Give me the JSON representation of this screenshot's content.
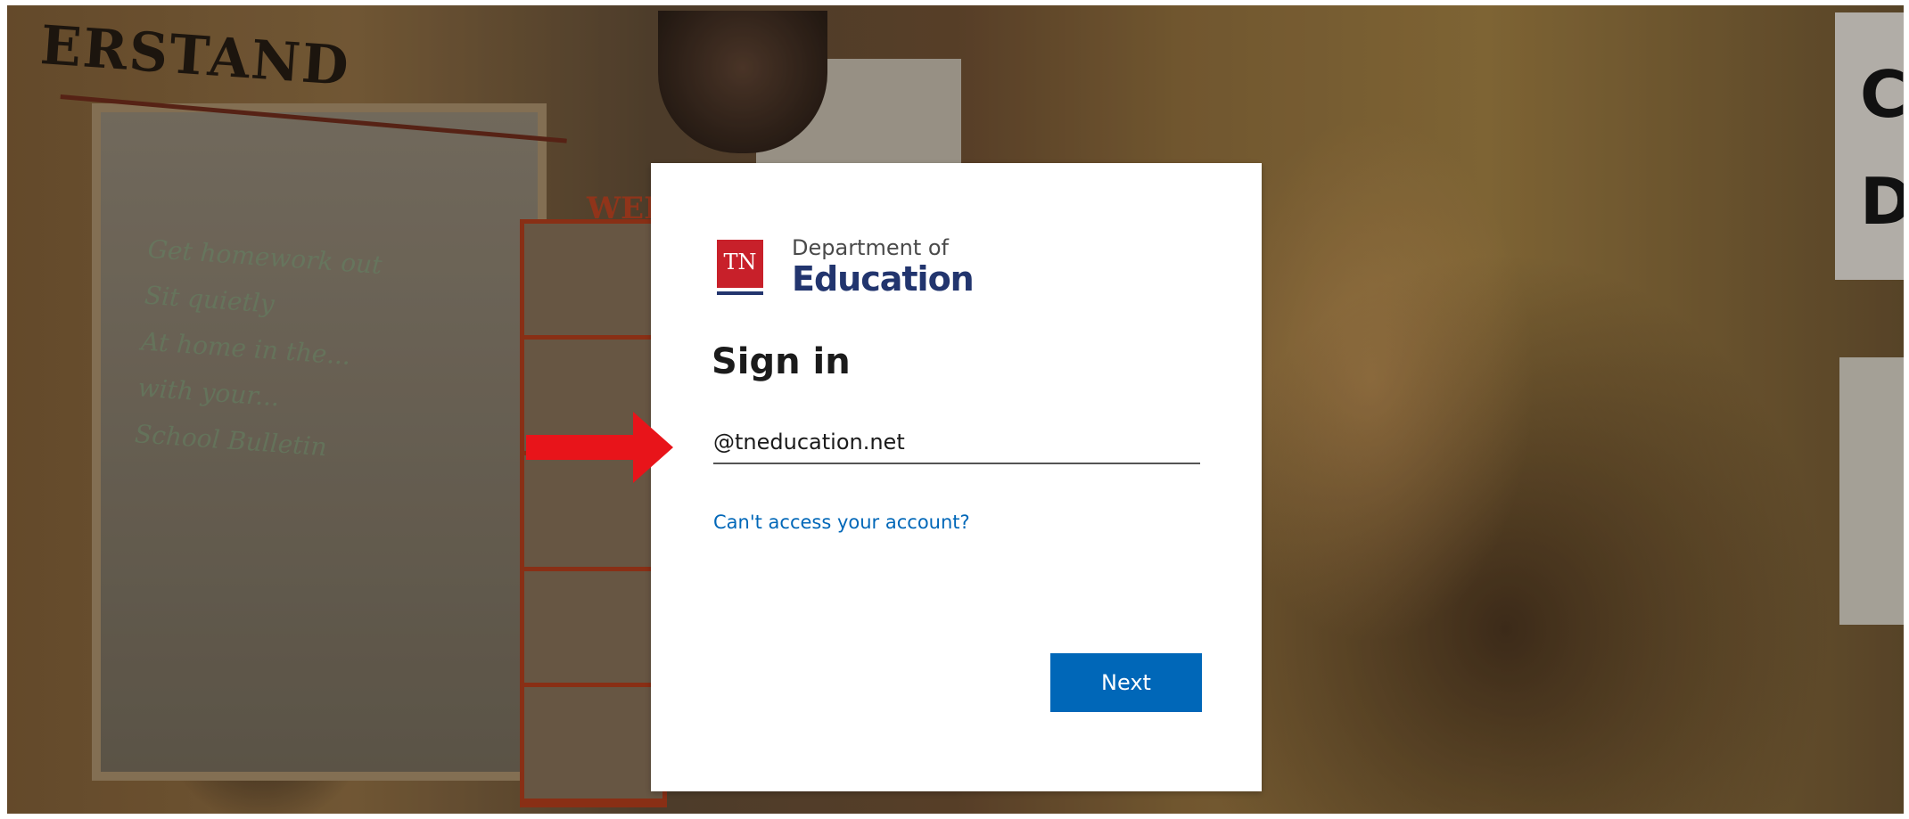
{
  "background": {
    "wall_text": "ERSTAND",
    "chart_label": "WEEK",
    "right_sign_letters": "C D",
    "whiteboard_lines": [
      "Get homework out",
      "Sit quietly",
      "At home in the...",
      "with your...",
      "School Bulletin"
    ]
  },
  "logo": {
    "badge_text": "TN",
    "line1": "Department of",
    "line2": "Education"
  },
  "signin": {
    "title": "Sign in",
    "email_value": "@tneducation.net",
    "cant_access_link": "Can't access your account?",
    "next_label": "Next"
  },
  "colors": {
    "accent_blue": "#0067b8",
    "tn_red": "#c8202a",
    "tn_navy": "#22356e",
    "annotation_arrow": "#e8141a"
  },
  "annotation": {
    "icon": "red-arrow-icon"
  }
}
